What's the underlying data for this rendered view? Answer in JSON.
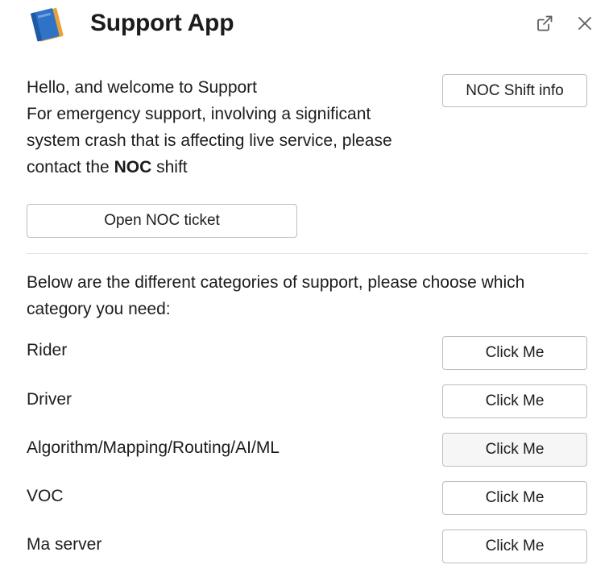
{
  "header": {
    "title": "Support App",
    "app_icon": "notebook-icon",
    "actions": [
      "external-link-icon",
      "close-icon"
    ]
  },
  "welcome": {
    "line1": "Hello, and welcome to",
    "line1_suffix": "Support",
    "line2": "For emergency support,  involving a significant",
    "line3": "system crash that is affecting live service, please",
    "line4_pre": "contact the",
    "line4_bold": "NOC",
    "line4_post": "shift"
  },
  "buttons": {
    "shift_info": "NOC Shift info",
    "open_ticket": "Open NOC ticket"
  },
  "categories_intro": "Below are the different categories of support, please choose which category you need:",
  "categories": [
    {
      "label": "Rider",
      "button": "Click Me"
    },
    {
      "label": "Driver",
      "button": "Click Me"
    },
    {
      "label": "Algorithm/Mapping/Routing/AI/ML",
      "button": "Click Me"
    },
    {
      "label": "VOC",
      "button": "Click Me"
    },
    {
      "label": "Ma server",
      "button": "Click Me"
    }
  ],
  "colors": {
    "text": "#1d1c1d",
    "border": "#bdbdbd",
    "divider": "#e2e2e2",
    "icon_blue": "#2f73c7",
    "icon_orange": "#e9a23b"
  }
}
